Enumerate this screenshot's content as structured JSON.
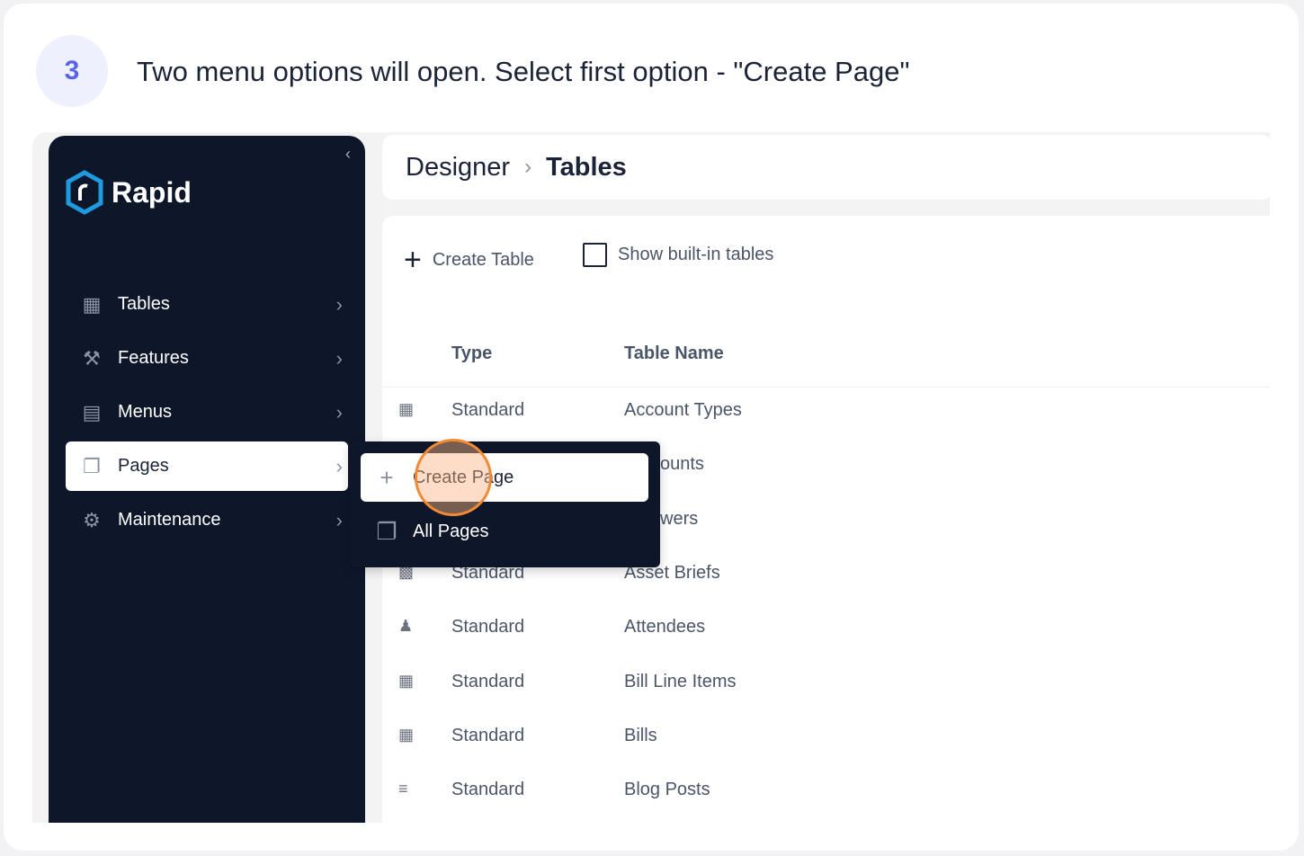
{
  "step": {
    "number": "3",
    "text": "Two menu options will open. Select first option - \"Create Page\""
  },
  "sidebar": {
    "logo": "Rapid",
    "items": [
      {
        "label": "Tables",
        "icon": "table-icon"
      },
      {
        "label": "Features",
        "icon": "robot-arm-icon"
      },
      {
        "label": "Menus",
        "icon": "menu-list-icon"
      },
      {
        "label": "Pages",
        "icon": "pages-icon",
        "active": true
      },
      {
        "label": "Maintenance",
        "icon": "tools-icon"
      }
    ]
  },
  "breadcrumb": {
    "parent": "Designer",
    "current": "Tables"
  },
  "toolbar": {
    "create_table": "Create Table",
    "show_builtin": "Show built-in tables",
    "show_builtin_checked": false
  },
  "table": {
    "headers": {
      "type": "Type",
      "name": "Table Name"
    },
    "rows": [
      {
        "type": "Standard",
        "name": "Account Types"
      },
      {
        "type": "",
        "name": "ounts"
      },
      {
        "type": "",
        "name": "wers"
      },
      {
        "type": "Standard",
        "name": "Asset Briefs"
      },
      {
        "type": "Standard",
        "name": "Attendees"
      },
      {
        "type": "Standard",
        "name": "Bill Line Items"
      },
      {
        "type": "Standard",
        "name": "Bills"
      },
      {
        "type": "Standard",
        "name": "Blog Posts"
      }
    ]
  },
  "popup": {
    "items": [
      {
        "label": "Create Page",
        "icon": "plus-icon"
      },
      {
        "label": "All Pages",
        "icon": "pages-icon"
      }
    ]
  },
  "colors": {
    "sidebar": "#0e1629",
    "highlight": "#f28a34",
    "step_badge": "#5b63e6"
  }
}
